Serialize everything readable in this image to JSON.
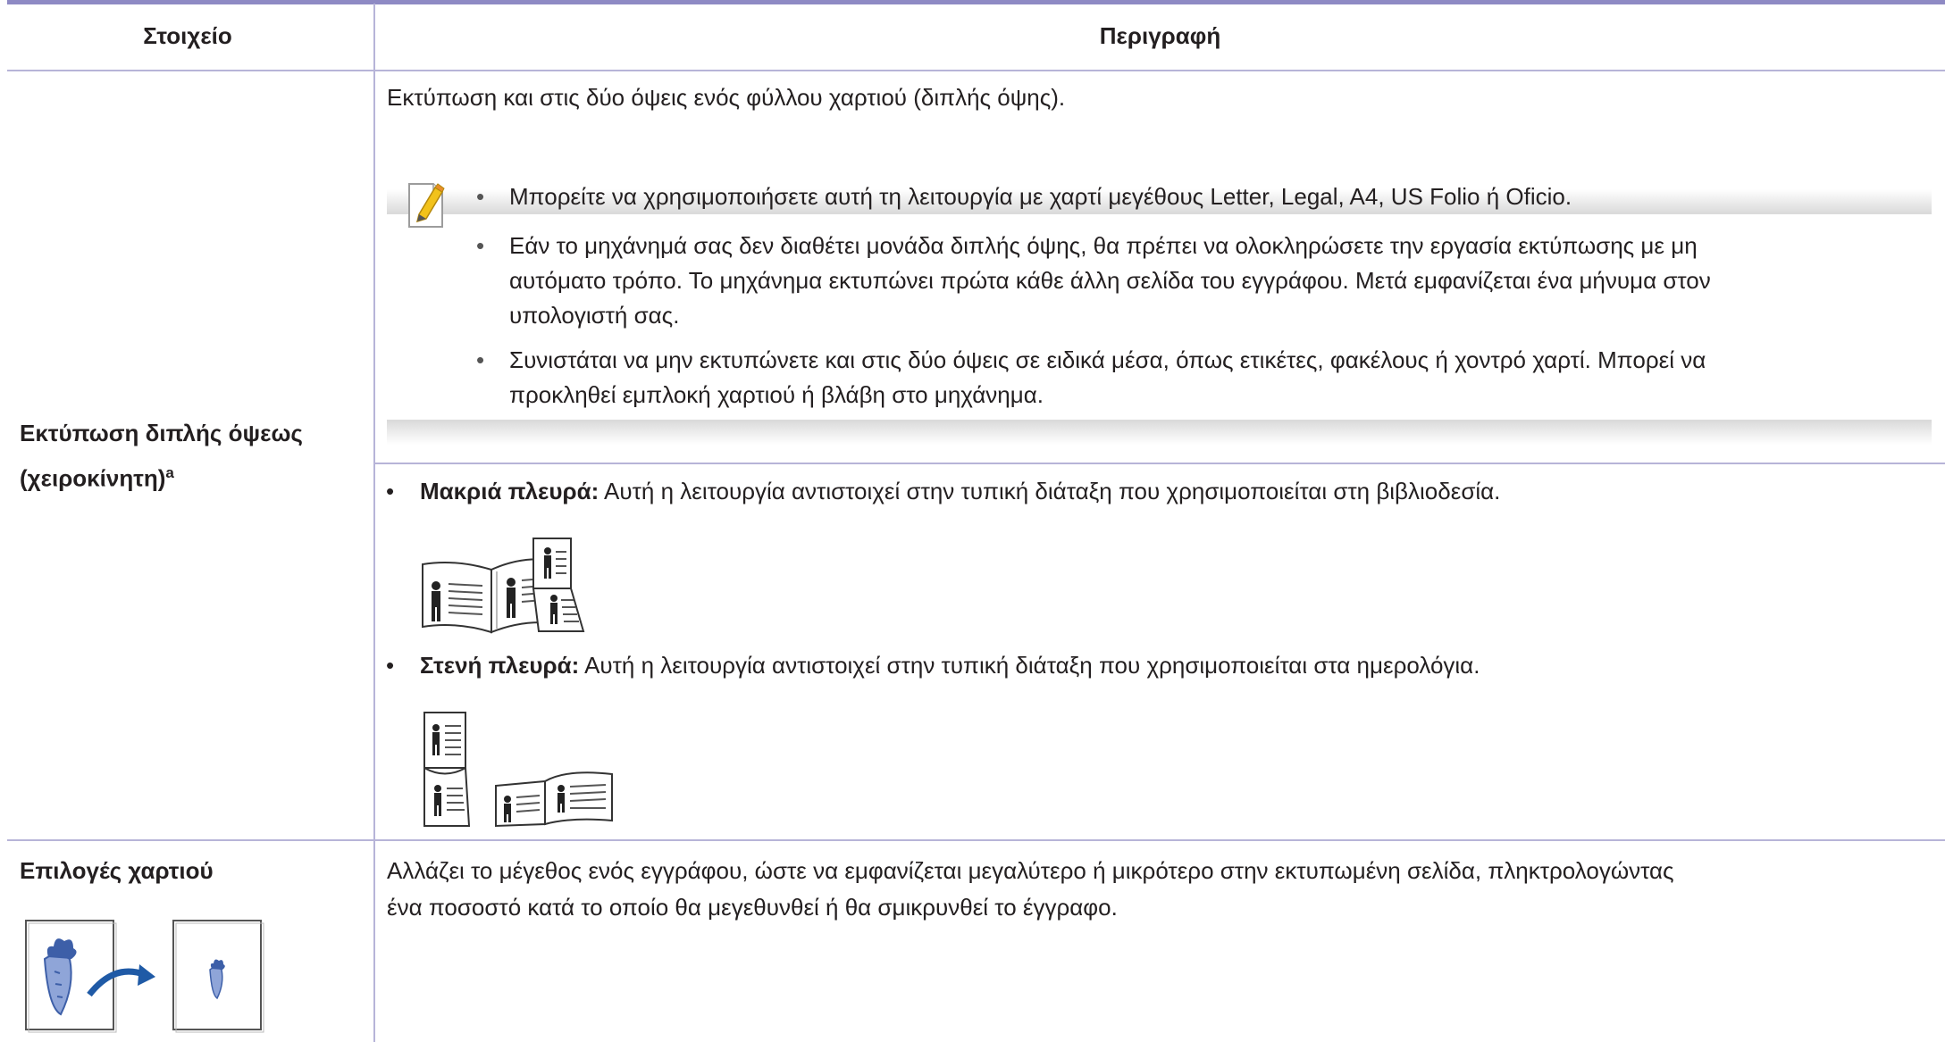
{
  "header": {
    "col_item": "Στοιχείο",
    "col_desc": "Περιγραφή"
  },
  "row1": {
    "label_line1": "Εκτύπωση διπλής όψεως",
    "label_line2": "(χειροκίνητη)",
    "label_sup": "a",
    "intro": "Εκτύπωση και στις δύο όψεις ενός φύλλου χαρτιού (διπλής όψης).",
    "notes": [
      {
        "lines": [
          "Μπορείτε να χρησιμοποιήσετε αυτή τη λειτουργία με χαρτί μεγέθους Letter, Legal, A4, US Folio ή Oficio."
        ]
      },
      {
        "lines": [
          "Εάν το μηχάνημά σας δεν διαθέτει μονάδα διπλής όψης, θα πρέπει να ολοκληρώσετε την εργασία εκτύπωσης με μη",
          "αυτόματο τρόπο. Το μηχάνημα εκτυπώνει πρώτα κάθε άλλη σελίδα του εγγράφου. Μετά εμφανίζεται ένα μήνυμα στον",
          "υπολογιστή σας."
        ]
      },
      {
        "lines": [
          "Συνιστάται να μην εκτυπώνετε και στις δύο όψεις σε ειδικά μέσα, όπως ετικέτες, φακέλους ή χοντρό χαρτί. Μπορεί να",
          "προκληθεί εμπλοκή χαρτιού ή βλάβη στο μηχάνημα."
        ]
      }
    ],
    "long_edge": {
      "term": "Μακριά πλευρά:",
      "text": " Αυτή η λειτουργία αντιστοιχεί στην τυπική διάταξη που χρησιμοποιείται στη βιβλιοδεσία."
    },
    "short_edge": {
      "term": "Στενή πλευρά:",
      "text": " Αυτή η λειτουργία αντιστοιχεί στην τυπική διάταξη που χρησιμοποιείται στα ημερολόγια."
    }
  },
  "row2": {
    "label": "Επιλογές χαρτιού",
    "desc_line1": "Αλλάζει το μέγεθος ενός εγγράφου, ώστε να εμφανίζεται μεγαλύτερο ή μικρότερο στην εκτυπωμένη σελίδα, πληκτρολογώντας",
    "desc_line2": "ένα ποσοστό κατά το οποίο θα μεγεθυνθεί ή θα σμικρυνθεί το έγγραφο."
  },
  "colors": {
    "rule": "#b7b4d8",
    "header_rule": "#8e8ac4",
    "note_icon_yellow": "#f2c21b",
    "carrot_blue": "#3d5fa8",
    "arrow_blue": "#1f5aa6"
  },
  "icons": [
    "note-pencil-icon",
    "long-edge-binding-icon",
    "short-edge-binding-icon",
    "reduce-enlarge-carrot-icon"
  ]
}
